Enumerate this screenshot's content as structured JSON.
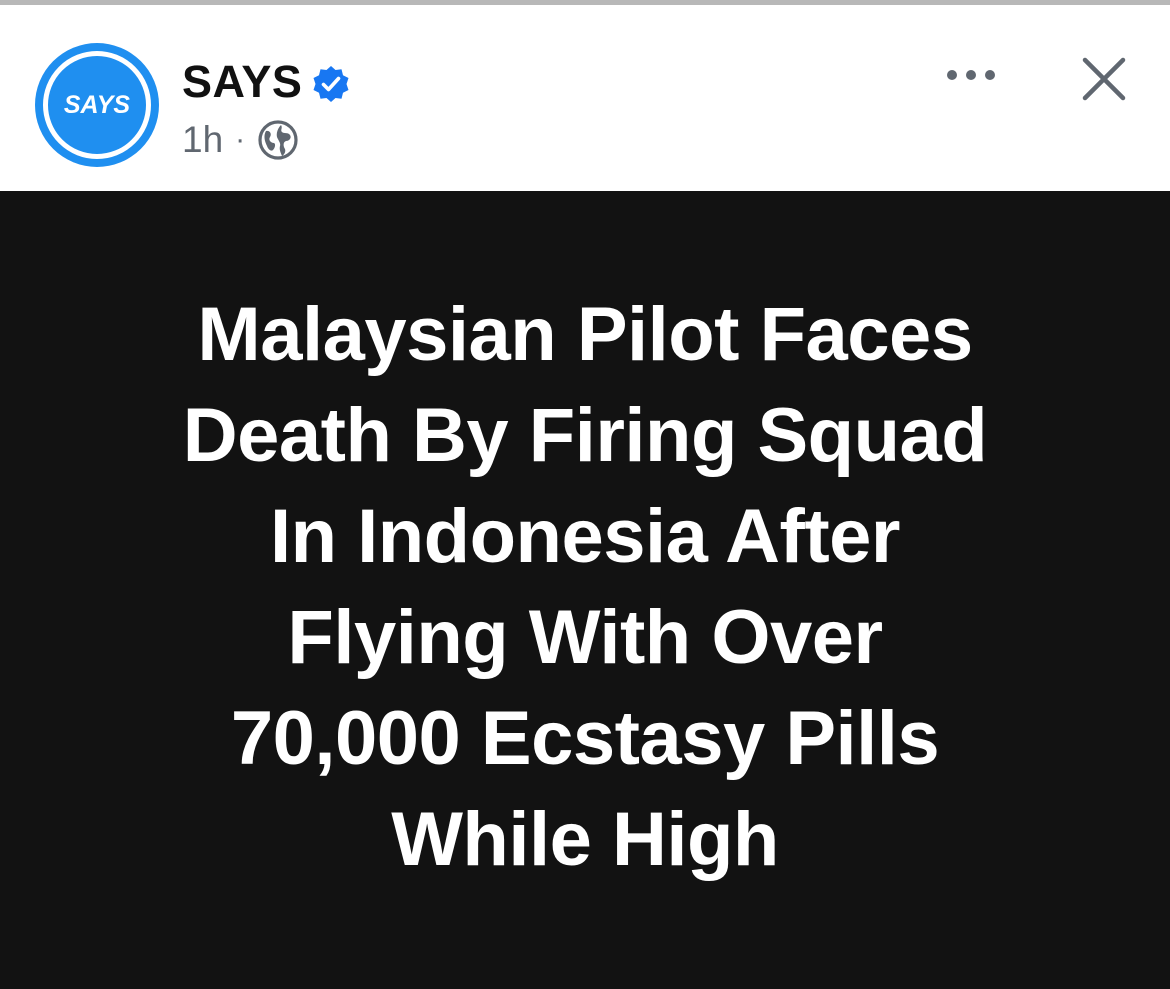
{
  "post": {
    "page_name": "SAYS",
    "avatar_text": "SAYS",
    "timestamp": "1h",
    "separator": "·",
    "audience_icon": "globe-icon",
    "verified_icon": "verified-badge-icon",
    "more_icon": "more-horizontal-icon",
    "close_icon": "close-icon"
  },
  "image": {
    "headline_lines": [
      "Malaysian Pilot Faces",
      "Death By Firing Squad",
      "In Indonesia After",
      "Flying With Over",
      "70,000 Ecstasy Pills",
      "While High"
    ]
  },
  "colors": {
    "brand_blue": "#1f8ff0",
    "verified_blue": "#1877f2",
    "image_background": "#121212",
    "headline_text": "#ffffff",
    "meta_text": "#606770"
  }
}
